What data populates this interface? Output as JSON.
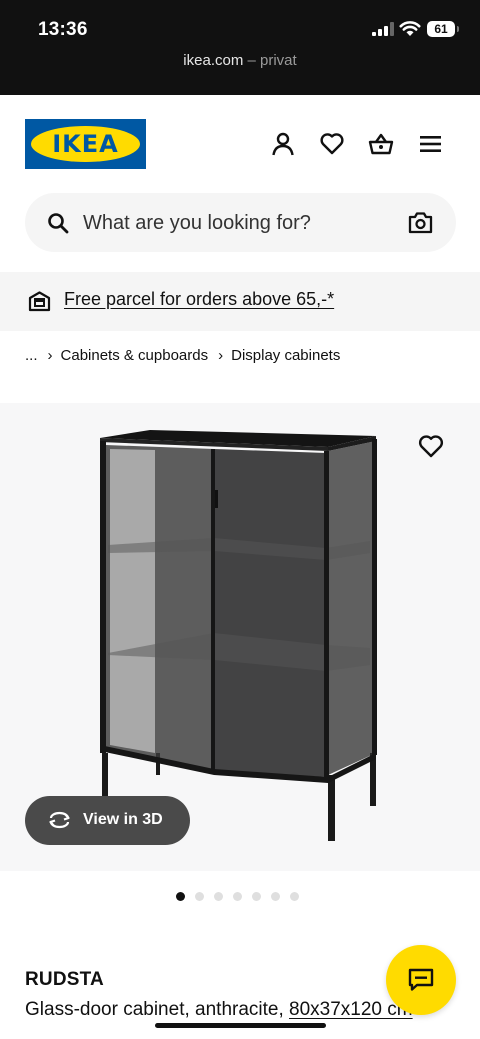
{
  "status_bar": {
    "time": "13:36",
    "battery": "61",
    "url_host": "ikea.com",
    "url_separator": " – ",
    "url_mode": "privat"
  },
  "header": {
    "logo_text": "IKEA",
    "icons": [
      "account-icon",
      "heart-icon",
      "basket-icon",
      "menu-icon"
    ]
  },
  "search": {
    "placeholder": "What are you looking for?"
  },
  "banner": {
    "text": "Free parcel for orders above 65,-*"
  },
  "breadcrumb": {
    "ellipsis": "...",
    "items": [
      "Cabinets & cupboards",
      "Display cabinets"
    ]
  },
  "gallery": {
    "view_3d_label": "View in 3D",
    "image_count": 7,
    "active_index": 0
  },
  "product": {
    "name": "RUDSTA",
    "description": "Glass-door cabinet, anthracite, ",
    "dimensions": "80x37x120 cm"
  },
  "colors": {
    "ikea_blue": "#0058a3",
    "ikea_yellow": "#ffdb00",
    "status_bar": "#111111"
  }
}
